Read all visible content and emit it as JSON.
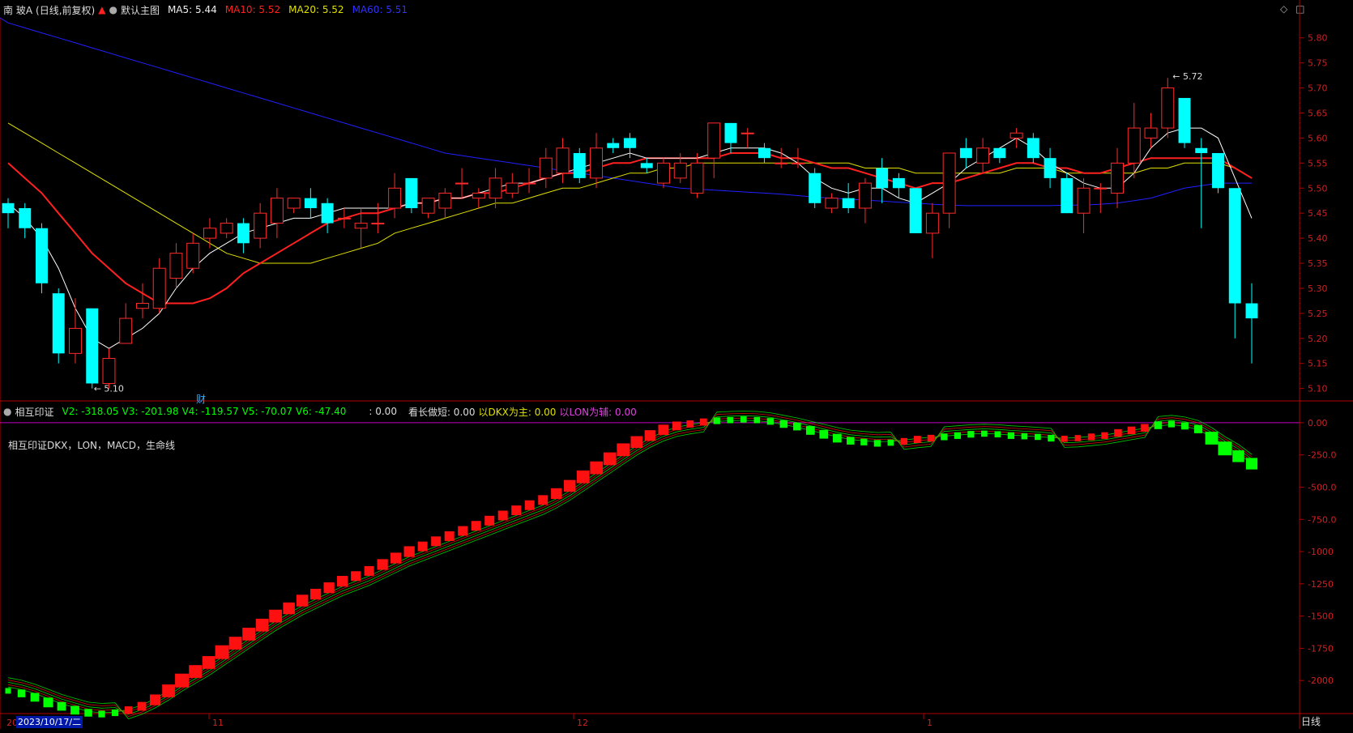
{
  "header": {
    "stock_name": "南 玻A",
    "period_info": "(日线,前复权)",
    "template_name": "默认主图",
    "ma5_label": "MA5: 5.44",
    "ma10_label": "MA10: 5.52",
    "ma20_label": "MA20: 5.52",
    "ma60_label": "MA60: 5.51"
  },
  "indicator": {
    "name": "相互印证",
    "v2": "V2: -318.05",
    "v3": "V3: -201.98",
    "v4": "V4: -119.57",
    "v5": "V5: -70.07",
    "v6": "V6: -47.40",
    "v7": ": 0.00",
    "long_short": "看长做短: 0.00",
    "dkx_main": "以DKX为主: 0.00",
    "lon_aux": "以LON为辅: 0.00",
    "subtitle": "相互印证DKX，LON，MACD，生命线"
  },
  "annotations": {
    "high_label": "5.72",
    "low_label": "5.10",
    "finance_marker": "财"
  },
  "axis": {
    "price_ticks": [
      "5.80",
      "5.75",
      "5.70",
      "5.65",
      "5.60",
      "5.55",
      "5.50",
      "5.45",
      "5.40",
      "5.35",
      "5.30",
      "5.25",
      "5.20",
      "5.15",
      "5.10"
    ],
    "indicator_ticks": [
      "0.00",
      "-250.0",
      "-500.0",
      "-750.0",
      "-1000",
      "-1250",
      "-1500",
      "-1750",
      "-2000"
    ],
    "month_labels": [
      "11",
      "12",
      "1"
    ],
    "year_prefix": "20",
    "cursor_date": "2023/10/17/二",
    "period": "日线"
  },
  "colors": {
    "up": "#ff2a2a",
    "down": "#00ffff",
    "ma5": "#ffffff",
    "ma10": "#ff2020",
    "ma20": "#e0e000",
    "ma60": "#2020ff",
    "ind_up": "#ff1010",
    "ind_down": "#00ff00",
    "zero_line": "#c000c0",
    "axis": "#b00000"
  },
  "chart_data": [
    {
      "type": "candlestick",
      "title": "南 玻A (日线,前复权)",
      "ylim": [
        5.08,
        5.84
      ],
      "y_ticks": [
        5.8,
        5.75,
        5.7,
        5.65,
        5.6,
        5.55,
        5.5,
        5.45,
        5.4,
        5.35,
        5.3,
        5.25,
        5.2,
        5.15,
        5.1
      ],
      "candles": [
        [
          5.47,
          5.45,
          5.48,
          5.42
        ],
        [
          5.46,
          5.42,
          5.47,
          5.4
        ],
        [
          5.42,
          5.31,
          5.43,
          5.29
        ],
        [
          5.29,
          5.17,
          5.3,
          5.15
        ],
        [
          5.17,
          5.22,
          5.28,
          5.15
        ],
        [
          5.26,
          5.11,
          5.26,
          5.1
        ],
        [
          5.11,
          5.16,
          5.18,
          5.1
        ],
        [
          5.19,
          5.24,
          5.27,
          5.19
        ],
        [
          5.26,
          5.27,
          5.31,
          5.24
        ],
        [
          5.26,
          5.34,
          5.36,
          5.25
        ],
        [
          5.32,
          5.37,
          5.39,
          5.3
        ],
        [
          5.34,
          5.39,
          5.41,
          5.33
        ],
        [
          5.4,
          5.42,
          5.44,
          5.38
        ],
        [
          5.41,
          5.43,
          5.44,
          5.4
        ],
        [
          5.43,
          5.39,
          5.44,
          5.37
        ],
        [
          5.4,
          5.45,
          5.47,
          5.38
        ],
        [
          5.43,
          5.48,
          5.5,
          5.4
        ],
        [
          5.46,
          5.48,
          5.48,
          5.45
        ],
        [
          5.48,
          5.46,
          5.5,
          5.44
        ],
        [
          5.47,
          5.43,
          5.48,
          5.41
        ],
        [
          5.44,
          5.44,
          5.46,
          5.42
        ],
        [
          5.42,
          5.43,
          5.46,
          5.38
        ],
        [
          5.43,
          5.43,
          5.47,
          5.41
        ],
        [
          5.46,
          5.5,
          5.53,
          5.44
        ],
        [
          5.52,
          5.46,
          5.52,
          5.45
        ],
        [
          5.45,
          5.48,
          5.48,
          5.44
        ],
        [
          5.46,
          5.49,
          5.5,
          5.44
        ],
        [
          5.51,
          5.51,
          5.54,
          5.48
        ],
        [
          5.48,
          5.49,
          5.5,
          5.46
        ],
        [
          5.48,
          5.52,
          5.54,
          5.46
        ],
        [
          5.49,
          5.51,
          5.53,
          5.48
        ],
        [
          5.51,
          5.51,
          5.54,
          5.49
        ],
        [
          5.52,
          5.56,
          5.58,
          5.5
        ],
        [
          5.53,
          5.58,
          5.6,
          5.51
        ],
        [
          5.57,
          5.52,
          5.58,
          5.51
        ],
        [
          5.52,
          5.58,
          5.61,
          5.5
        ],
        [
          5.59,
          5.58,
          5.6,
          5.57
        ],
        [
          5.6,
          5.58,
          5.61,
          5.56
        ],
        [
          5.55,
          5.54,
          5.56,
          5.53
        ],
        [
          5.51,
          5.55,
          5.56,
          5.5
        ],
        [
          5.52,
          5.55,
          5.57,
          5.51
        ],
        [
          5.49,
          5.55,
          5.57,
          5.48
        ],
        [
          5.56,
          5.63,
          5.63,
          5.52
        ],
        [
          5.63,
          5.59,
          5.63,
          5.57
        ],
        [
          5.61,
          5.61,
          5.62,
          5.58
        ],
        [
          5.58,
          5.56,
          5.59,
          5.55
        ],
        [
          5.55,
          5.55,
          5.58,
          5.54
        ],
        [
          5.55,
          5.55,
          5.58,
          5.54
        ],
        [
          5.53,
          5.47,
          5.54,
          5.46
        ],
        [
          5.46,
          5.48,
          5.49,
          5.45
        ],
        [
          5.48,
          5.46,
          5.51,
          5.45
        ],
        [
          5.46,
          5.51,
          5.52,
          5.43
        ],
        [
          5.54,
          5.5,
          5.56,
          5.47
        ],
        [
          5.52,
          5.5,
          5.53,
          5.48
        ],
        [
          5.5,
          5.41,
          5.5,
          5.41
        ],
        [
          5.41,
          5.45,
          5.47,
          5.36
        ],
        [
          5.45,
          5.57,
          5.57,
          5.42
        ],
        [
          5.58,
          5.56,
          5.6,
          5.54
        ],
        [
          5.55,
          5.58,
          5.6,
          5.53
        ],
        [
          5.58,
          5.56,
          5.58,
          5.55
        ],
        [
          5.6,
          5.61,
          5.62,
          5.58
        ],
        [
          5.6,
          5.56,
          5.61,
          5.55
        ],
        [
          5.56,
          5.52,
          5.58,
          5.5
        ],
        [
          5.52,
          5.45,
          5.53,
          5.45
        ],
        [
          5.45,
          5.5,
          5.52,
          5.41
        ],
        [
          5.5,
          5.5,
          5.51,
          5.45
        ],
        [
          5.49,
          5.55,
          5.58,
          5.46
        ],
        [
          5.55,
          5.62,
          5.67,
          5.52
        ],
        [
          5.6,
          5.62,
          5.65,
          5.58
        ],
        [
          5.62,
          5.7,
          5.72,
          5.6
        ],
        [
          5.68,
          5.59,
          5.68,
          5.58
        ],
        [
          5.58,
          5.57,
          5.6,
          5.42
        ],
        [
          5.57,
          5.5,
          5.57,
          5.49
        ],
        [
          5.5,
          5.27,
          5.5,
          5.2
        ],
        [
          5.27,
          5.24,
          5.31,
          5.15
        ]
      ],
      "ma5": [
        5.47,
        5.44,
        5.4,
        5.34,
        5.26,
        5.2,
        5.18,
        5.2,
        5.22,
        5.25,
        5.3,
        5.34,
        5.37,
        5.39,
        5.41,
        5.42,
        5.43,
        5.44,
        5.44,
        5.45,
        5.46,
        5.46,
        5.46,
        5.46,
        5.47,
        5.47,
        5.48,
        5.48,
        5.49,
        5.5,
        5.51,
        5.51,
        5.52,
        5.53,
        5.54,
        5.55,
        5.56,
        5.57,
        5.56,
        5.56,
        5.56,
        5.56,
        5.57,
        5.58,
        5.58,
        5.58,
        5.57,
        5.55,
        5.52,
        5.5,
        5.49,
        5.5,
        5.5,
        5.48,
        5.47,
        5.49,
        5.51,
        5.54,
        5.56,
        5.58,
        5.6,
        5.58,
        5.55,
        5.53,
        5.51,
        5.5,
        5.5,
        5.53,
        5.58,
        5.61,
        5.62,
        5.62,
        5.6,
        5.52,
        5.44
      ],
      "ma10": [
        5.55,
        5.52,
        5.49,
        5.45,
        5.41,
        5.37,
        5.34,
        5.31,
        5.29,
        5.27,
        5.27,
        5.27,
        5.28,
        5.3,
        5.33,
        5.35,
        5.37,
        5.39,
        5.41,
        5.43,
        5.44,
        5.45,
        5.45,
        5.46,
        5.47,
        5.47,
        5.48,
        5.48,
        5.49,
        5.49,
        5.5,
        5.51,
        5.52,
        5.53,
        5.53,
        5.54,
        5.55,
        5.55,
        5.56,
        5.56,
        5.56,
        5.56,
        5.56,
        5.57,
        5.57,
        5.57,
        5.56,
        5.56,
        5.55,
        5.54,
        5.54,
        5.53,
        5.52,
        5.51,
        5.5,
        5.51,
        5.51,
        5.52,
        5.53,
        5.54,
        5.55,
        5.55,
        5.54,
        5.54,
        5.53,
        5.53,
        5.54,
        5.55,
        5.56,
        5.56,
        5.56,
        5.56,
        5.56,
        5.54,
        5.52
      ],
      "ma20": [
        5.63,
        5.61,
        5.59,
        5.57,
        5.55,
        5.53,
        5.51,
        5.49,
        5.47,
        5.45,
        5.43,
        5.41,
        5.39,
        5.37,
        5.36,
        5.35,
        5.35,
        5.35,
        5.35,
        5.36,
        5.37,
        5.38,
        5.39,
        5.41,
        5.42,
        5.43,
        5.44,
        5.45,
        5.46,
        5.47,
        5.47,
        5.48,
        5.49,
        5.5,
        5.5,
        5.51,
        5.52,
        5.53,
        5.53,
        5.54,
        5.54,
        5.55,
        5.55,
        5.55,
        5.55,
        5.55,
        5.55,
        5.55,
        5.55,
        5.55,
        5.55,
        5.54,
        5.54,
        5.54,
        5.53,
        5.53,
        5.53,
        5.53,
        5.53,
        5.53,
        5.54,
        5.54,
        5.54,
        5.53,
        5.53,
        5.53,
        5.53,
        5.53,
        5.54,
        5.54,
        5.55,
        5.55,
        5.55,
        5.54,
        5.52
      ],
      "ma60": [
        5.83,
        5.82,
        5.81,
        5.8,
        5.79,
        5.78,
        5.77,
        5.76,
        5.75,
        5.74,
        5.73,
        5.72,
        5.71,
        5.7,
        5.69,
        5.68,
        5.67,
        5.66,
        5.65,
        5.64,
        5.63,
        5.62,
        5.61,
        5.6,
        5.59,
        5.58,
        5.57,
        5.565,
        5.56,
        5.555,
        5.55,
        5.545,
        5.54,
        5.535,
        5.53,
        5.525,
        5.52,
        5.515,
        5.51,
        5.505,
        5.5,
        5.498,
        5.496,
        5.494,
        5.492,
        5.49,
        5.488,
        5.485,
        5.482,
        5.48,
        5.478,
        5.476,
        5.474,
        5.472,
        5.47,
        5.468,
        5.466,
        5.465,
        5.465,
        5.465,
        5.465,
        5.465,
        5.465,
        5.466,
        5.466,
        5.468,
        5.47,
        5.475,
        5.48,
        5.49,
        5.5,
        5.505,
        5.51,
        5.51,
        5.51
      ]
    },
    {
      "type": "bar",
      "title": "相互印证",
      "ylim": [
        -2250,
        150
      ],
      "y_ticks": [
        0,
        -250,
        -500,
        -750,
        -1000,
        -1250,
        -1500,
        -1750,
        -2000
      ],
      "values": [
        -2080,
        -2100,
        -2130,
        -2170,
        -2200,
        -2230,
        -2250,
        -2260,
        -2250,
        -2230,
        -2200,
        -2150,
        -2080,
        -2000,
        -1930,
        -1860,
        -1780,
        -1710,
        -1640,
        -1570,
        -1500,
        -1440,
        -1380,
        -1330,
        -1280,
        -1230,
        -1190,
        -1150,
        -1100,
        -1050,
        -1000,
        -960,
        -920,
        -880,
        -840,
        -800,
        -760,
        -720,
        -680,
        -640,
        -600,
        -550,
        -490,
        -420,
        -350,
        -280,
        -210,
        -150,
        -100,
        -55,
        -25,
        -10,
        5,
        15,
        20,
        25,
        20,
        10,
        -10,
        -30,
        -60,
        -90,
        -120,
        -140,
        -150,
        -160,
        -155,
        -145,
        -130,
        -120,
        -110,
        -100,
        -90,
        -85,
        -90,
        -100,
        -105,
        -110,
        -120,
        -125,
        -120,
        -110,
        -100,
        -80,
        -60,
        -40,
        -20,
        -10,
        -25,
        -50,
        -120,
        -200,
        -260,
        -318
      ],
      "bar_colors": [
        "g",
        "g",
        "g",
        "g",
        "g",
        "g",
        "g",
        "g",
        "g",
        "r",
        "r",
        "r",
        "r",
        "r",
        "r",
        "r",
        "r",
        "r",
        "r",
        "r",
        "r",
        "r",
        "r",
        "r",
        "r",
        "r",
        "r",
        "r",
        "r",
        "r",
        "r",
        "r",
        "r",
        "r",
        "r",
        "r",
        "r",
        "r",
        "r",
        "r",
        "r",
        "r",
        "r",
        "r",
        "r",
        "r",
        "r",
        "r",
        "r",
        "r",
        "r",
        "r",
        "r",
        "g",
        "g",
        "g",
        "g",
        "g",
        "g",
        "g",
        "g",
        "g",
        "g",
        "g",
        "g",
        "g",
        "g",
        "r",
        "r",
        "r",
        "g",
        "g",
        "g",
        "g",
        "g",
        "g",
        "g",
        "g",
        "g",
        "r",
        "r",
        "r",
        "r",
        "r",
        "r",
        "r",
        "g",
        "g",
        "g",
        "g",
        "g",
        "g",
        "g",
        "g"
      ],
      "series": [
        {
          "name": "V2",
          "values": [
            -2050,
            -2070,
            -2100,
            -2140,
            -2180,
            -2210,
            -2240,
            -2250,
            -2245,
            -2225,
            -2190,
            -2140,
            -2080,
            -2010,
            -1950,
            -1890,
            -1820,
            -1750,
            -1680,
            -1610,
            -1540,
            -1480,
            -1420,
            -1370,
            -1320,
            -1270,
            -1230,
            -1190,
            -1140,
            -1090,
            -1040,
            -1000,
            -960,
            -920,
            -880,
            -840,
            -800,
            -760,
            -720,
            -680,
            -640,
            -590,
            -530,
            -460,
            -390,
            -320,
            -250,
            -180,
            -120,
            -70,
            -35,
            -15,
            0,
            10,
            15,
            18,
            15,
            5,
            -15,
            -35,
            -60,
            -85,
            -110,
            -130,
            -140,
            -148,
            -145,
            -135,
            -122,
            -112,
            -104,
            -96,
            -88,
            -84,
            -88,
            -96,
            -102,
            -108,
            -116,
            -120,
            -116,
            -106,
            -96,
            -78,
            -60,
            -42,
            -25,
            -15,
            -28,
            -55,
            -110,
            -180,
            -240,
            -318
          ]
        }
      ]
    }
  ]
}
